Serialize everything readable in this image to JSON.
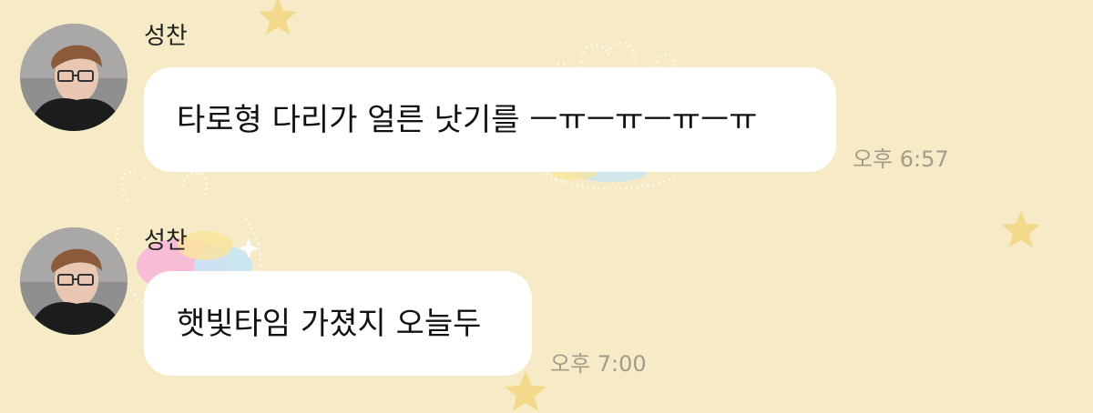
{
  "chat": {
    "messages": [
      {
        "sender": "성찬",
        "text": "타로형 다리가 얼른 낫기를 ㅡㅠㅡㅠㅡㅠㅡㅠ",
        "time": "오후 6:57"
      },
      {
        "sender": "성찬",
        "text": "햇빛타임 가졌지 오늘두",
        "time": "오후 7:00"
      }
    ]
  },
  "avatar": {
    "icon": "profile-photo-icon"
  },
  "colors": {
    "background": "#f6ebc6",
    "bubble": "#ffffff",
    "time_text": "#a49c8a",
    "star": "#f3d98c"
  }
}
